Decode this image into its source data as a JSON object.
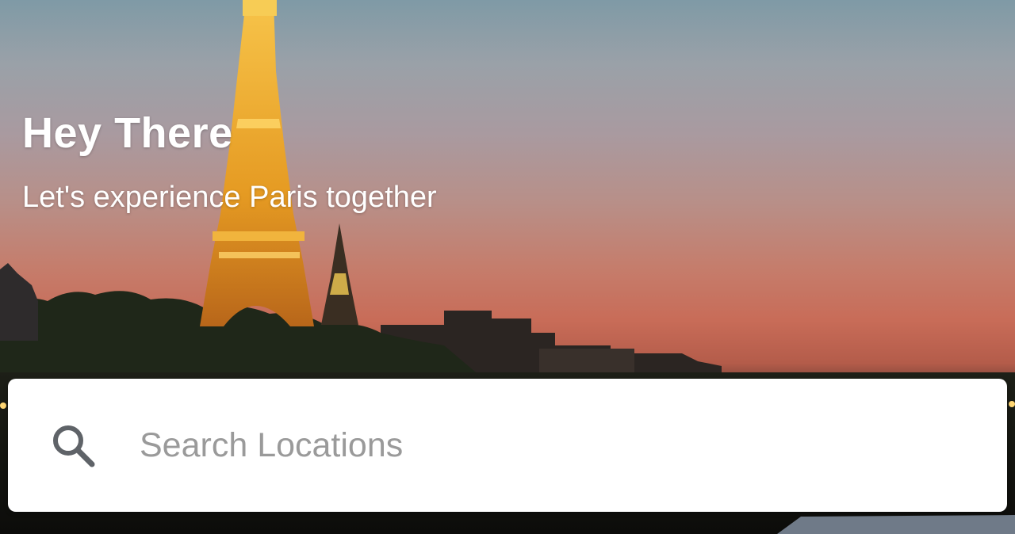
{
  "hero": {
    "title": "Hey There",
    "subtitle": "Let's experience Paris together",
    "background_image": "eiffel-tower-dusk-photo"
  },
  "search": {
    "placeholder": "Search Locations",
    "value": "",
    "icon": "search-icon"
  },
  "colors": {
    "card_bg": "#ffffff",
    "placeholder_text": "#9a9a9a",
    "icon": "#5f6368",
    "hero_text": "#ffffff"
  }
}
